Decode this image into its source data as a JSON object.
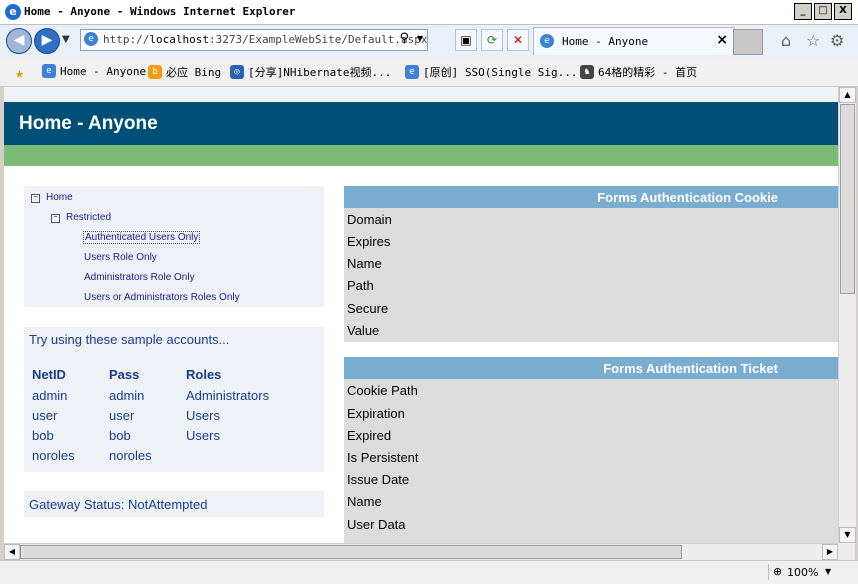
{
  "window": {
    "title": "Home - Anyone - Windows Internet Explorer",
    "min": "_",
    "max": "□",
    "close": "X"
  },
  "nav": {
    "url_prefix": "http://",
    "url_host": "localhost",
    "url_rest": ":3273/ExampleWebSite/Default.aspx",
    "tab_label": "Home - Anyone",
    "tab_close": "×"
  },
  "favorites": [
    {
      "label": "Home - Anyone",
      "icon": "ie-page-icon",
      "color": "#3b82d6"
    },
    {
      "label": "必应 Bing",
      "icon": "bing-icon",
      "color": "#f39c12"
    },
    {
      "label": "[分享]NHibernate视频...",
      "icon": "cnblogs-icon",
      "color": "#2a62b6"
    },
    {
      "label": "[原创] SSO(Single Sig...",
      "icon": "ie-page-icon",
      "color": "#3b82d6"
    },
    {
      "label": "64格的精彩 - 首页",
      "icon": "chess-icon",
      "color": "#444444"
    }
  ],
  "page": {
    "title": "Home - Anyone",
    "tree": {
      "home": "Home",
      "restricted": "Restricted",
      "items": [
        "Authenticated Users Only",
        "Users Role Only",
        "Administrators Role Only",
        "Users or Administrators Roles Only"
      ]
    },
    "accounts": {
      "intro": "Try using these sample accounts...",
      "headers": [
        "NetID",
        "Pass",
        "Roles"
      ],
      "rows": [
        [
          "admin",
          "admin",
          "Administrators"
        ],
        [
          "user",
          "user",
          "Users"
        ],
        [
          "bob",
          "bob",
          "Users"
        ],
        [
          "noroles",
          "noroles",
          ""
        ]
      ]
    },
    "gateway": "Gateway Status: NotAttempted",
    "cookie": {
      "title": "Forms Authentication Cookie",
      "fields": [
        "Domain",
        "Expires",
        "Name",
        "Path",
        "Secure",
        "Value"
      ]
    },
    "ticket": {
      "title": "Forms Authentication Ticket",
      "fields": [
        "Cookie Path",
        "Expiration",
        "Expired",
        "Is Persistent",
        "Issue Date",
        "Name",
        "User Data"
      ]
    }
  },
  "status": {
    "zoom": "100%"
  }
}
